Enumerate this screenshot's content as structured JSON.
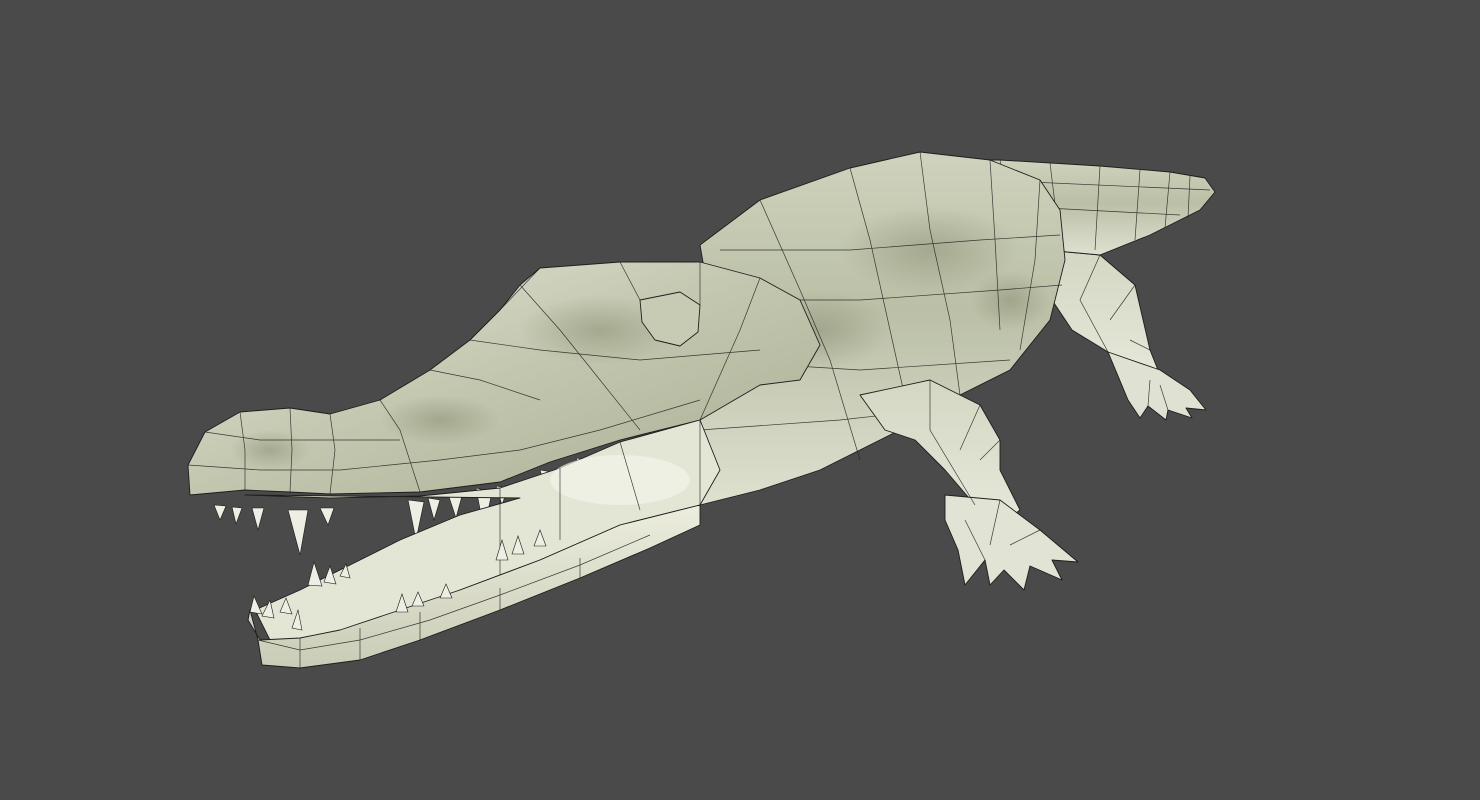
{
  "scene": {
    "model_icon": "crocodile-model-icon",
    "colors": {
      "background": "#4a4a4a",
      "skin_light": "#dcdfcc",
      "skin_mid": "#b7bca2",
      "skin_dark": "#8e9379",
      "mouth_inner": "#e6e7d6",
      "wireframe": "#1e1e1c",
      "tooth": "#eeeee4"
    }
  }
}
